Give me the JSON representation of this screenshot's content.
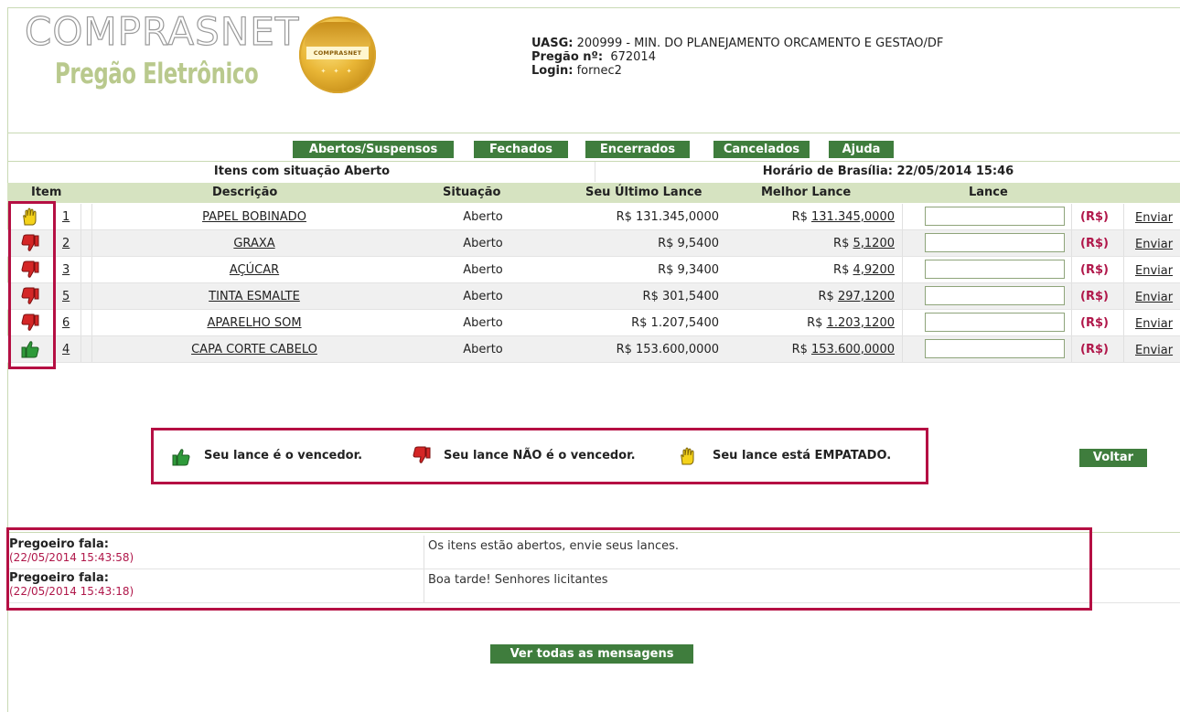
{
  "header": {
    "logo_title": "COMPRASNET",
    "logo_subtitle": "Pregão Eletrônico",
    "seal_text": "COMPRASNET",
    "uasg_label": "UASG:",
    "uasg_value": "200999 - MIN. DO PLANEJAMENTO ORCAMENTO E GESTAO/DF",
    "pregao_label": "Pregão nº:",
    "pregao_value": "672014",
    "login_label": "Login:",
    "login_value": "fornec2"
  },
  "tabs": [
    {
      "label": "Abertos/Suspensos"
    },
    {
      "label": "Fechados"
    },
    {
      "label": "Encerrados"
    },
    {
      "label": "Cancelados"
    },
    {
      "label": "Ajuda"
    }
  ],
  "status_title": "Itens com situação Aberto",
  "horario": "Horário de Brasília: 22/05/2014 15:46",
  "table": {
    "headers": {
      "item": "Item",
      "descricao": "Descrição",
      "situacao": "Situação",
      "ultimo": "Seu Último Lance",
      "melhor": "Melhor Lance",
      "lance": "Lance"
    },
    "rows": [
      {
        "icon": "tied-hand-icon",
        "item": "1",
        "descricao": "PAPEL BOBINADO",
        "situacao": "Aberto",
        "ultimo": "R$ 131.345,0000",
        "melhor_prefix": "R$",
        "melhor": "131.345,0000",
        "currency": "(R$)",
        "action": "Enviar"
      },
      {
        "icon": "thumbs-down-icon",
        "item": "2",
        "descricao": "GRAXA",
        "situacao": "Aberto",
        "ultimo": "R$ 9,5400",
        "melhor_prefix": "R$",
        "melhor": "5,1200",
        "currency": "(R$)",
        "action": "Enviar"
      },
      {
        "icon": "thumbs-down-icon",
        "item": "3",
        "descricao": "AÇÚCAR",
        "situacao": "Aberto",
        "ultimo": "R$ 9,3400",
        "melhor_prefix": "R$",
        "melhor": "4,9200",
        "currency": "(R$)",
        "action": "Enviar"
      },
      {
        "icon": "thumbs-down-icon",
        "item": "5",
        "descricao": "TINTA ESMALTE",
        "situacao": "Aberto",
        "ultimo": "R$ 301,5400",
        "melhor_prefix": "R$",
        "melhor": "297,1200",
        "currency": "(R$)",
        "action": "Enviar"
      },
      {
        "icon": "thumbs-down-icon",
        "item": "6",
        "descricao": "APARELHO SOM",
        "situacao": "Aberto",
        "ultimo": "R$ 1.207,5400",
        "melhor_prefix": "R$",
        "melhor": "1.203,1200",
        "currency": "(R$)",
        "action": "Enviar"
      },
      {
        "icon": "thumbs-up-icon",
        "item": "4",
        "descricao": "CAPA CORTE CABELO",
        "situacao": "Aberto",
        "ultimo": "R$ 153.600,0000",
        "melhor_prefix": "R$",
        "melhor": "153.600,0000",
        "currency": "(R$)",
        "action": "Enviar"
      }
    ]
  },
  "legend": {
    "winner": "Seu lance é o vencedor.",
    "not_winner": "Seu lance NÃO é o vencedor.",
    "tied": "Seu lance está EMPATADO."
  },
  "voltar": "Voltar",
  "messages": [
    {
      "speaker": "Pregoeiro fala:",
      "time": "(22/05/2014 15:43:58)",
      "text": "Os itens estão abertos, envie seus lances."
    },
    {
      "speaker": "Pregoeiro fala:",
      "time": "(22/05/2014 15:43:18)",
      "text": "Boa tarde! Senhores licitantes"
    }
  ],
  "ver_todas": "Ver todas as mensagens",
  "colors": {
    "accent_green": "#3f7d3d",
    "header_band": "#d6e3c1",
    "highlight_red": "#b50f43",
    "currency_red": "#b0174a"
  }
}
